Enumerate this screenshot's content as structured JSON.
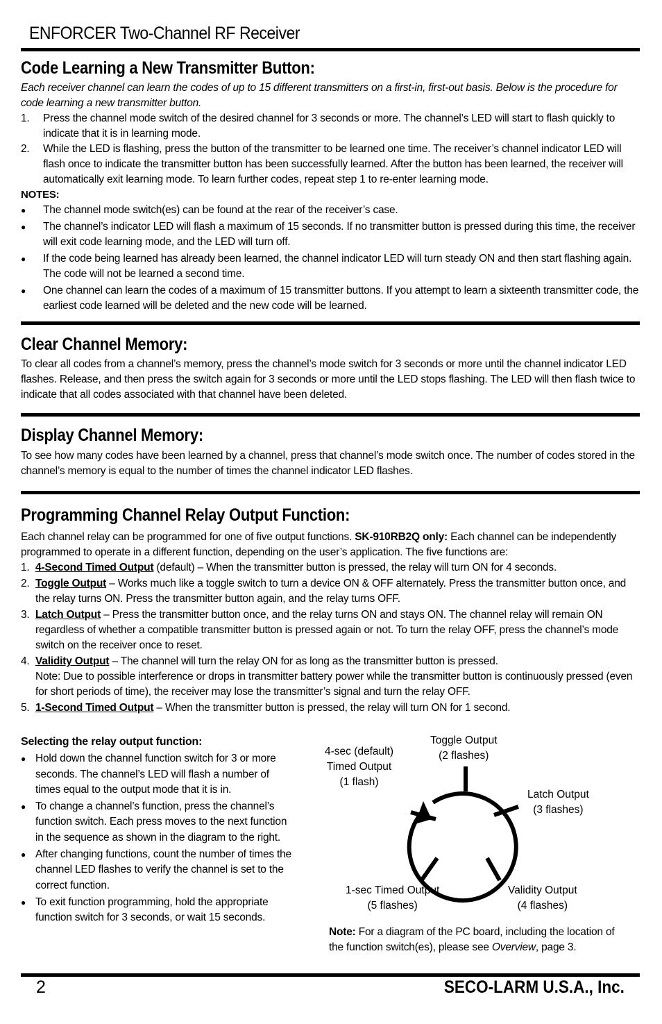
{
  "header": {
    "title": "ENFORCER Two-Channel RF Receiver"
  },
  "code_learning": {
    "heading": "Code Learning a New Transmitter Button:",
    "intro": "Each receiver channel can learn the codes of up to 15 different transmitters on a first-in, first-out basis. Below is the procedure for code learning a new transmitter button.",
    "steps": [
      {
        "num": "1.",
        "text": "Press the channel mode switch of the desired channel for 3 seconds or more. The channel’s LED will start to flash quickly to indicate that it is in learning mode."
      },
      {
        "num": "2.",
        "text": "While the LED is flashing, press the button of the transmitter to be learned one time. The receiver’s channel indicator LED will flash once to indicate the transmitter button has been successfully learned. After the button has been learned, the receiver will automatically exit learning mode. To learn further codes, repeat step 1 to re-enter learning mode."
      }
    ],
    "notes_label": "NOTES:",
    "notes": [
      "The channel mode switch(es) can be found at the rear of the receiver’s case.",
      "The channel’s indicator LED will flash a maximum of 15 seconds. If no transmitter button is pressed during this time, the receiver will exit code learning mode, and the LED will turn off.",
      "If the code being learned has already been learned, the channel indicator LED will turn steady ON and then start flashing again. The code will not be learned a second time.",
      "One channel can learn the codes of a maximum of 15 transmitter buttons. If you attempt to learn a sixteenth transmitter code, the earliest code learned will be deleted and the new code will be learned."
    ]
  },
  "clear_memory": {
    "heading": "Clear Channel Memory:",
    "text": "To clear all codes from a channel’s memory, press the channel’s mode switch for 3 seconds or more until the channel indicator LED flashes.  Release, and then press the switch again for 3 seconds or more until the LED stops flashing. The LED will then flash twice to indicate that all codes associated with that channel have been deleted."
  },
  "display_memory": {
    "heading": "Display Channel Memory:",
    "text": "To see how many codes have been learned by a channel, press that channel’s mode switch once. The number of codes stored in the channel’s memory is equal to the number of times the channel indicator LED flashes."
  },
  "relay": {
    "heading": "Programming Channel Relay Output Function:",
    "intro_a": "Each channel relay can be programmed for one of five output functions. ",
    "intro_bold": "SK-910RB2Q only:",
    "intro_b": " Each channel can be independently programmed to operate in a different function, depending on the user’s application. The five functions are:",
    "functions": [
      {
        "num": "1.",
        "name": "4-Second Timed Output",
        "text": " (default) – When the transmitter button is pressed, the relay will turn ON for 4 seconds.",
        "note": ""
      },
      {
        "num": "2.",
        "name": "Toggle Output",
        "text": " – Works much like a toggle switch to turn a device ON & OFF alternately. Press the transmitter button once, and the relay turns ON. Press the transmitter button again, and the relay turns OFF.",
        "note": ""
      },
      {
        "num": "3.",
        "name": "Latch Output",
        "text": " – Press the transmitter button once, and the relay turns ON and stays ON. The channel relay will remain ON regardless of whether a compatible transmitter button is pressed again or not. To turn the relay OFF, press the channel’s mode switch on the receiver once to reset.",
        "note": ""
      },
      {
        "num": "4.",
        "name": "Validity Output",
        "text": " – The channel will turn the relay ON for as long as the transmitter button is pressed.",
        "note": "Note: Due to possible interference or drops in transmitter battery power while the transmitter button is continuously pressed (even for short periods of time), the receiver may lose the transmitter’s signal and turn the relay OFF."
      },
      {
        "num": "5.",
        "name": "1-Second Timed Output",
        "text": " – When the transmitter button is pressed, the relay will turn ON for 1 second.",
        "note": ""
      }
    ]
  },
  "selecting": {
    "heading": "Selecting the relay output function:",
    "bullets": [
      "Hold down the channel function switch for 3 or more seconds. The channel’s LED will flash a number of times equal to the output mode that it is in.",
      "To change a channel’s function, press the channel’s function switch. Each press moves to the next function in the sequence as shown in the diagram to the right.",
      "After changing functions, count the number of times the channel LED flashes to verify the channel is set to the correct function.",
      "To exit function programming, hold the appropriate function switch for 3 seconds, or wait 15 seconds."
    ]
  },
  "diagram": {
    "labels": [
      {
        "line1": "4-sec (default)",
        "line2": "Timed Output",
        "line3": "(1 flash)"
      },
      {
        "line1": "Toggle Output",
        "line2": "(2 flashes)"
      },
      {
        "line1": "Latch Output",
        "line2": "(3 flashes)"
      },
      {
        "line1": "Validity Output",
        "line2": "(4 flashes)"
      },
      {
        "line1": "1-sec Timed Output",
        "line2": "(5 flashes)"
      }
    ]
  },
  "board_note": {
    "label": "Note:",
    "text_a": " For a diagram of the PC board, including the location of the function switch(es), please see ",
    "italic": "Overview",
    "text_b": ", page 3."
  },
  "footer": {
    "page_number": "2",
    "company": "SECO-LARM U.S.A., Inc."
  }
}
